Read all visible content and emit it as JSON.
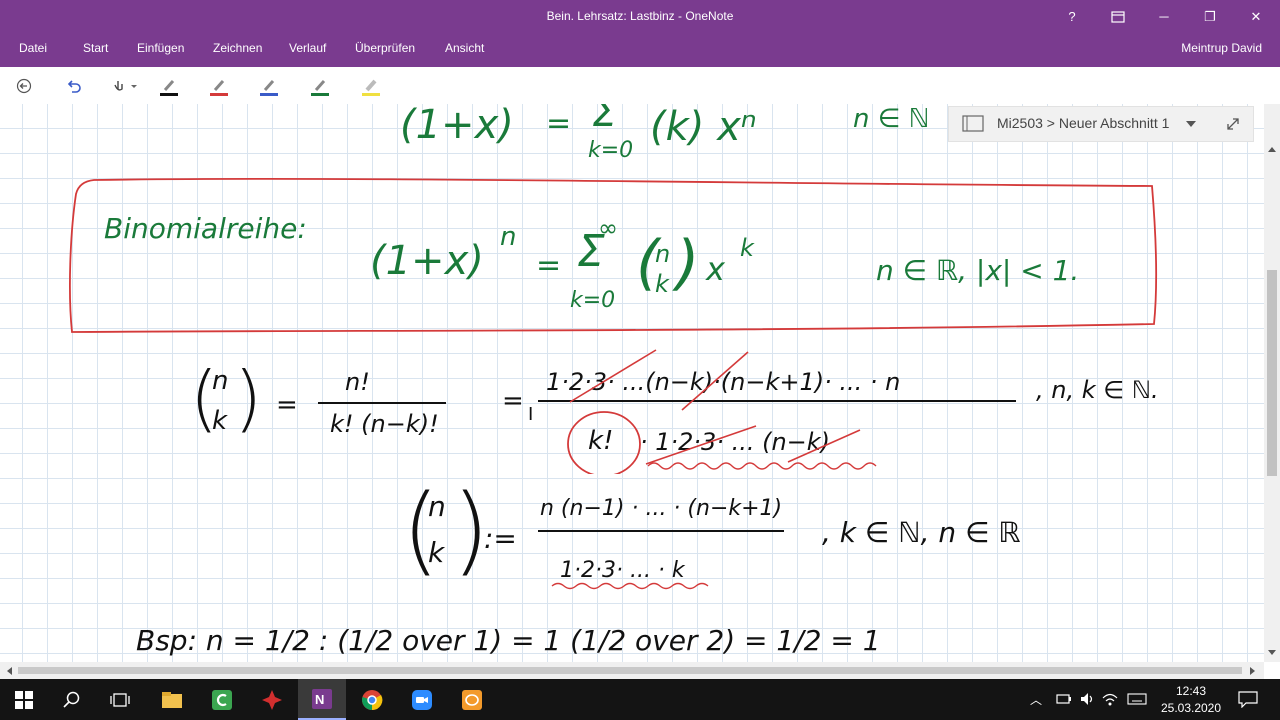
{
  "window": {
    "title": "Bein. Lehrsatz: Lastbinz - OneNote",
    "help_label": "?",
    "buttons": {
      "restore_icon": "restore-icon",
      "minimize": "─",
      "maximize": "❐",
      "close": "✕"
    }
  },
  "menu": {
    "tabs": [
      "Datei",
      "Start",
      "Einfügen",
      "Zeichnen",
      "Verlauf",
      "Überprüfen",
      "Ansicht"
    ],
    "user": "Meintrup David"
  },
  "toolbar": {
    "tools": [
      "back-icon",
      "undo-icon",
      "touch-draw-icon"
    ],
    "pen_colors": [
      "#111111",
      "#d43a3a",
      "#3a5bc8",
      "#1a7a3a",
      "#f0e040"
    ]
  },
  "section": {
    "breadcrumb": "Mi2503 > Neuer Abschnitt 1",
    "expand_icon": "expand-icon"
  },
  "notes": {
    "top_formula_lhs": "(1+x)",
    "top_formula_eq": "=",
    "top_formula_sum": "k=0",
    "top_formula_rest": "(k) xⁿ",
    "top_formula_domain": "n ∈ ℕ",
    "box_title": "Binomialreihe:",
    "box_lhs": "(1+x)",
    "box_exp": "n",
    "box_eq": "=",
    "box_sum_top": "∞",
    "box_sum_bottom": "k=0",
    "box_binom_top": "n",
    "box_binom_bottom": "k",
    "box_x": "x",
    "box_x_exp": "k",
    "box_domain": "n ∈ ℝ,  |x| < 1.",
    "def1_binom_top": "n",
    "def1_binom_bottom": "k",
    "def1_eq": "=",
    "def1_num": "n!",
    "def1_den": "k! (n−k)!",
    "def1_eq2": "=",
    "def1_num2": "1·2·3· ...(n−k)·(n−k+1)· ... · n",
    "def1_den2_circle": "k!",
    "def1_den2_rest": "· 1·2·3· ... (n−k)",
    "def1_domain": ", n, k ∈ ℕ.",
    "def2_binom_top": "n",
    "def2_binom_bottom": "k",
    "def2_eq": ":=",
    "def2_num": "n (n−1) · ... · (n−k+1)",
    "def2_den": "1·2·3· ... · k",
    "def2_domain": ",  k ∈ ℕ,  n ∈ ℝ",
    "bsp": "Bsp:  n = 1/2 :   (1/2 over 1) = 1    (1/2 over 2) =  1/2  = 1"
  },
  "taskbar": {
    "apps": [
      "windows-start-icon",
      "search-icon",
      "task-view-icon",
      "file-explorer-icon",
      "camtasia-icon",
      "app-icon",
      "onenote-icon",
      "chrome-icon",
      "zoom-icon",
      "geogebra-icon"
    ],
    "time": "12:43",
    "date": "25.03.2020"
  }
}
